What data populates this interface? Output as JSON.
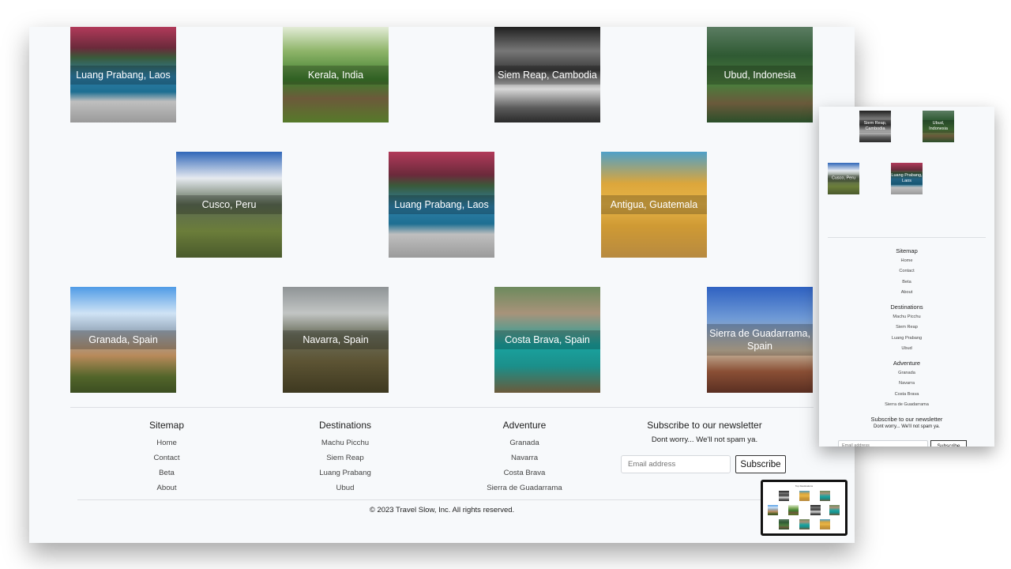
{
  "desktop": {
    "cards": [
      {
        "label": "Luang Prabang, Laos",
        "icon": "photo-laos"
      },
      {
        "label": "Kerala, India",
        "icon": "photo-kerala"
      },
      {
        "label": "Siem Reap, Cambodia",
        "icon": "photo-siem-reap"
      },
      {
        "label": "Ubud, Indonesia",
        "icon": "photo-ubud"
      },
      {
        "label": "Cusco, Peru",
        "icon": "photo-cusco"
      },
      {
        "label": "Luang Prabang, Laos",
        "icon": "photo-laos"
      },
      {
        "label": "Antigua, Guatemala",
        "icon": "photo-antigua"
      },
      {
        "label": "Granada, Spain",
        "icon": "photo-granada"
      },
      {
        "label": "Navarra, Spain",
        "icon": "photo-navarra"
      },
      {
        "label": "Costa Brava, Spain",
        "icon": "photo-costa-brava"
      },
      {
        "label": "Sierra de Guadarrama, Spain",
        "icon": "photo-sierra"
      }
    ],
    "footer": {
      "sitemap": {
        "title": "Sitemap",
        "links": [
          "Home",
          "Contact",
          "Beta",
          "About"
        ]
      },
      "destinations": {
        "title": "Destinations",
        "links": [
          "Machu Picchu",
          "Siem Reap",
          "Luang Prabang",
          "Ubud"
        ]
      },
      "adventure": {
        "title": "Adventure",
        "links": [
          "Granada",
          "Navarra",
          "Costa Brava",
          "Sierra de Guadarrama"
        ]
      },
      "newsletter": {
        "title": "Subscribe to our newsletter",
        "subtitle": "Dont worry... We'll not spam ya.",
        "email_placeholder": "Email address",
        "button": "Subscribe"
      },
      "copyright": "© 2023 Travel Slow, Inc. All rights reserved."
    }
  },
  "mobile": {
    "cards": [
      {
        "label": "Siem Reap, Cambodia"
      },
      {
        "label": "Ubud, Indonesia"
      },
      {
        "label": "Cusco, Peru"
      },
      {
        "label": "Luang Prabang, Laos"
      }
    ],
    "footer": {
      "sitemap": {
        "title": "Sitemap",
        "links": [
          "Home",
          "Contact",
          "Beta",
          "About"
        ]
      },
      "destinations": {
        "title": "Destinations",
        "links": [
          "Machu Picchu",
          "Siem Reap",
          "Luang Prabang",
          "Ubud"
        ]
      },
      "adventure": {
        "title": "Adventure",
        "links": [
          "Granada",
          "Navarra",
          "Costa Brava",
          "Sierra de Guadarrama"
        ]
      },
      "newsletter_title": "Subscribe to our newsletter",
      "newsletter_subtitle": "Dont worry... We'll not spam ya.",
      "email_placeholder": "Email address",
      "button": "Subscribe"
    }
  },
  "tablet_thumb": {
    "title": "Top Destinations"
  }
}
